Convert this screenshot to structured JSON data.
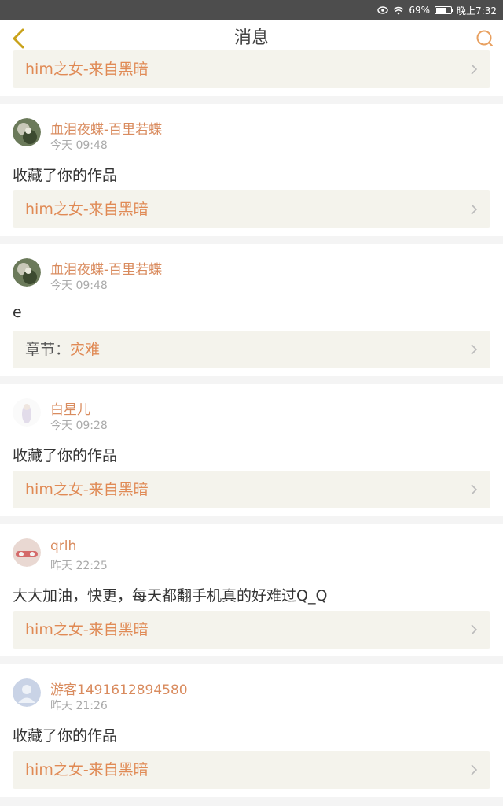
{
  "status": {
    "battery": "69%",
    "time": "晚上7:32",
    "battery_level": 0.69
  },
  "header": {
    "title": "消息",
    "back_icon": "chevron-left-icon",
    "search_icon": "search-icon"
  },
  "colors": {
    "accent": "#d98b5e",
    "link": "#e08a55",
    "back": "#c9a21a",
    "search": "#e8a060"
  },
  "feed": {
    "top_link": "him之女-来自黑暗",
    "items": [
      {
        "username": "血泪夜蝶-百里若蝶",
        "time": "今天 09:48",
        "content": "收藏了你的作品",
        "link": "him之女-来自黑暗"
      },
      {
        "username": "血泪夜蝶-百里若蝶",
        "time": "今天 09:48",
        "content": "e",
        "chapter_label": "章节：",
        "link": "灾难"
      },
      {
        "username": "白星儿",
        "time": "今天 09:28",
        "content": "收藏了你的作品",
        "link": "him之女-来自黑暗"
      },
      {
        "username": "qrlh",
        "time": "昨天 22:25",
        "content": "大大加油，快更，每天都翻手机真的好难过Q_Q",
        "link": "him之女-来自黑暗"
      },
      {
        "username": "游客1491612894580",
        "time": "昨天 21:26",
        "content": "收藏了你的作品",
        "link": "him之女-来自黑暗"
      }
    ]
  }
}
